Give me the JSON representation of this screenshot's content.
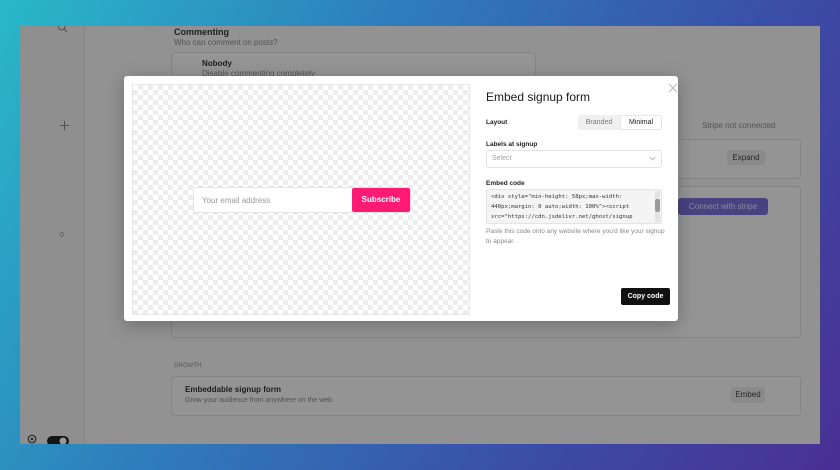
{
  "background": {
    "commenting_title": "Commenting",
    "commenting_subtitle": "Who can comment on posts?",
    "option_title": "Nobody",
    "option_subtitle": "Disable commenting completely",
    "stripe_status": "Stripe not connected",
    "expand_label": "Expand",
    "connect_label": "Connect with stripe",
    "section_growth": "GROWTH",
    "embeddable_title": "Embeddable signup form",
    "embeddable_subtitle": "Grow your audience from anywhere on the web",
    "embed_btn": "Embed",
    "badge_count": "0"
  },
  "preview": {
    "email_placeholder": "Your email address",
    "subscribe_label": "Subscribe",
    "subscribe_color": "#ff1a75"
  },
  "modal": {
    "title": "Embed signup form",
    "close_icon": "close-x",
    "layout_label": "Layout",
    "layout_options": [
      "Branded",
      "Minimal"
    ],
    "layout_selected": "Minimal",
    "labels_label": "Labels at signup",
    "select_placeholder": "Select",
    "embed_code_label": "Embed code",
    "code_lines": [
      "<div style=\"min-height: 58px;max-width:",
      "440px;margin: 0 auto;width: 100%\"><script",
      "src=\"https://cdn.jsdelivr.net/ghost/signup"
    ],
    "hint_text": "Paste this code onto any website where you'd like your signup to appear.",
    "copy_label": "Copy code"
  },
  "icons": [
    "search-icon",
    "plus-icon",
    "settings-icon",
    "toggle-icon",
    "close-icon",
    "chevron-down-icon",
    "stripe-icon"
  ]
}
